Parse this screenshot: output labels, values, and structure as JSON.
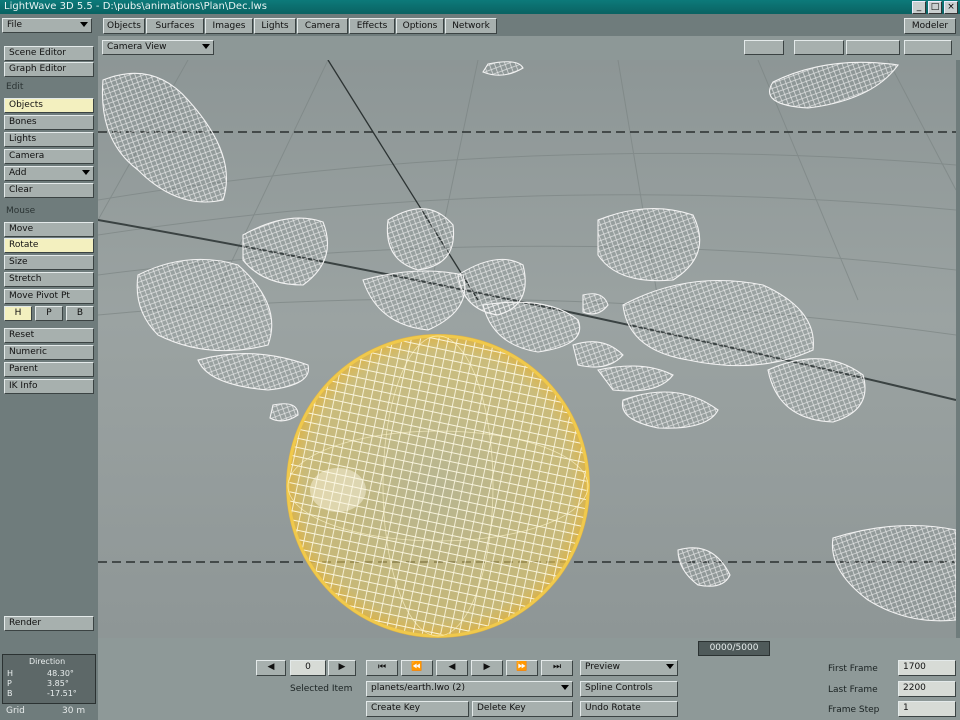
{
  "window": {
    "title": "LightWave 3D 5.5 - D:\\pubs\\animations\\Plan\\Dec.lws",
    "controls": [
      "_",
      "□",
      "×"
    ]
  },
  "top_menu": {
    "file_dropdown": "File",
    "tabs": [
      "Objects",
      "Surfaces",
      "Images",
      "Lights",
      "Camera",
      "Effects",
      "Options",
      "Network"
    ],
    "modeler_button": "Modeler"
  },
  "left_panel": {
    "buttons_top": [
      "Scene Editor",
      "Graph Editor"
    ],
    "edit_label": "Edit",
    "edit_items": [
      "Objects",
      "Bones",
      "Lights",
      "Camera"
    ],
    "add_dropdown": "Add",
    "clear_button": "Clear",
    "mouse_label": "Mouse",
    "mouse_items": [
      "Move",
      "Rotate",
      "Size",
      "Stretch",
      "Move Pivot Pt"
    ],
    "axis_buttons": [
      "H",
      "P",
      "B"
    ],
    "lower_items": [
      "Reset",
      "Numeric",
      "Parent",
      "IK Info"
    ],
    "render_button": "Render",
    "readout": {
      "title": "Direction",
      "rows": [
        {
          "axis": "H",
          "value": "48.30°"
        },
        {
          "axis": "P",
          "value": "3.85°"
        },
        {
          "axis": "B",
          "value": "-17.51°"
        }
      ],
      "grid_label": "Grid",
      "grid_value": "30 m"
    }
  },
  "viewport": {
    "view_dropdown": "Camera View",
    "wireframe_color": "#ffffff",
    "selected_color": "#f4d768"
  },
  "bottom_bar": {
    "frame_display": "0000/5000",
    "frame_value": "0",
    "transport": [
      "⏮",
      "⏪",
      "◀",
      "▶",
      "⏩",
      "⏭"
    ],
    "selected_item_label": "Selected Item",
    "selected_item_value": "planets/earth.lwo (2)",
    "preview_dropdown": "Preview",
    "buttons": [
      "Create Key",
      "Delete Key",
      "Spline Controls",
      "Undo Rotate"
    ],
    "first_frame_label": "First Frame",
    "first_frame_value": "1700",
    "last_frame_label": "Last Frame",
    "last_frame_value": "2200",
    "frame_step_label": "Frame Step",
    "frame_step_value": "1"
  }
}
